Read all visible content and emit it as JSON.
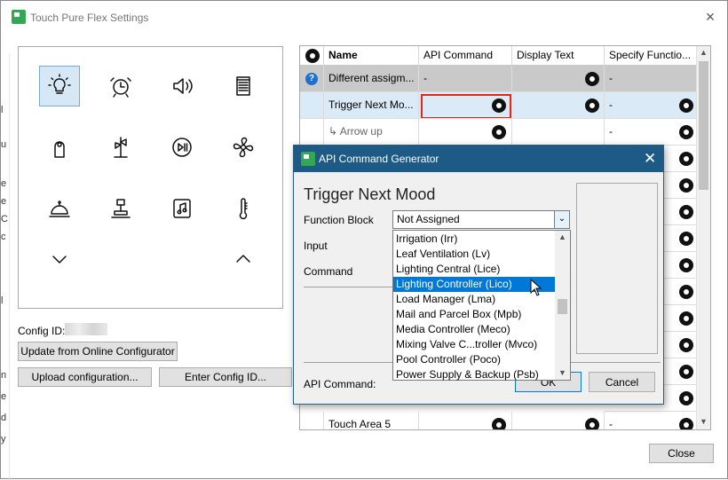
{
  "window": {
    "title": "Touch Pure Flex Settings",
    "close_glyph": "×"
  },
  "left_edge_chars": [
    "l",
    "u",
    "e",
    "e",
    "C",
    "c",
    "l",
    "n",
    "e",
    "d",
    "y"
  ],
  "icon_grid": [
    {
      "name": "lightbulb-icon",
      "selected": true
    },
    {
      "name": "alarm-clock-icon",
      "selected": false
    },
    {
      "name": "speaker-icon",
      "selected": false
    },
    {
      "name": "blinds-icon",
      "selected": false
    },
    {
      "name": "door-hanger-icon",
      "selected": false
    },
    {
      "name": "signpost-icon",
      "selected": false
    },
    {
      "name": "play-pause-icon",
      "selected": false
    },
    {
      "name": "fan-icon",
      "selected": false
    },
    {
      "name": "room-service-icon",
      "selected": false
    },
    {
      "name": "desk-lamp-icon",
      "selected": false
    },
    {
      "name": "music-note-icon",
      "selected": false
    },
    {
      "name": "thermometer-icon",
      "selected": false
    },
    {
      "name": "chevron-down-icon",
      "selected": false
    },
    {
      "name": "chevron-up-icon",
      "selected": false
    }
  ],
  "config": {
    "label": "Config ID:",
    "update_button": "Update from Online Configurator",
    "upload_button": "Upload configuration...",
    "enter_button": "Enter Config ID..."
  },
  "table": {
    "headers": [
      "Name",
      "API Command",
      "Display Text",
      "Specify Functio..."
    ],
    "rows": [
      {
        "name": "Different assigm...",
        "api": "-",
        "display_gear": true,
        "specify": "-",
        "style": "gray",
        "help": true
      },
      {
        "name": "Trigger Next Mo...",
        "api": "",
        "display_gear": true,
        "specify": "-",
        "style": "selected",
        "help": false
      },
      {
        "name": "↳ Arrow up",
        "api": "",
        "display_gear": false,
        "specify": "-",
        "style": "sub",
        "help": false
      },
      {
        "name": "",
        "api": "",
        "display_gear": false,
        "specify": "",
        "style": "normal",
        "help": false
      },
      {
        "name": "",
        "api": "",
        "display_gear": false,
        "specify": "",
        "style": "normal",
        "help": false
      },
      {
        "name": "",
        "api": "",
        "display_gear": false,
        "specify": "",
        "style": "normal",
        "help": false
      },
      {
        "name": "",
        "api": "",
        "display_gear": false,
        "specify": "",
        "style": "normal",
        "help": false
      },
      {
        "name": "",
        "api": "",
        "display_gear": false,
        "specify": "",
        "style": "normal",
        "help": false
      },
      {
        "name": "",
        "api": "",
        "display_gear": false,
        "specify": "",
        "style": "normal",
        "help": false
      },
      {
        "name": "",
        "api": "",
        "display_gear": false,
        "specify": "",
        "style": "normal",
        "help": false
      },
      {
        "name": "",
        "api": "",
        "display_gear": false,
        "specify": "",
        "style": "normal",
        "help": false
      },
      {
        "name": "",
        "api": "",
        "display_gear": false,
        "specify": "",
        "style": "normal",
        "help": false
      },
      {
        "name": "",
        "api": "",
        "display_gear": false,
        "specify": "",
        "style": "normal",
        "help": false
      },
      {
        "name": "Touch Area 5",
        "api": "",
        "display_gear": true,
        "specify": "-",
        "style": "normal",
        "help": false
      }
    ]
  },
  "dialog": {
    "title": "API Command Generator",
    "close_glyph": "✕",
    "heading": "Trigger Next Mood",
    "function_block_label": "Function Block",
    "function_block_value": "Not Assigned",
    "input_label": "Input",
    "command_label": "Command",
    "api_command_label": "API Command:",
    "ok_button": "OK",
    "cancel_button": "Cancel"
  },
  "dropdown": {
    "items": [
      "Irrigation (Irr)",
      "Leaf Ventilation (Lv)",
      "Lighting Central (Lice)",
      "Lighting Controller (Lico)",
      "Load Manager (Lma)",
      "Mail and Parcel Box (Mpb)",
      "Media Controller (Meco)",
      "Mixing Valve C...troller (Mvco)",
      "Pool Controller (Poco)",
      "Power Supply & Backup (Psb)"
    ],
    "highlighted_index": 3
  },
  "footer": {
    "close_button": "Close"
  },
  "colors": {
    "accent": "#0078d7",
    "dialog_title": "#1d5a85",
    "highlight_frame": "#e0261b"
  }
}
